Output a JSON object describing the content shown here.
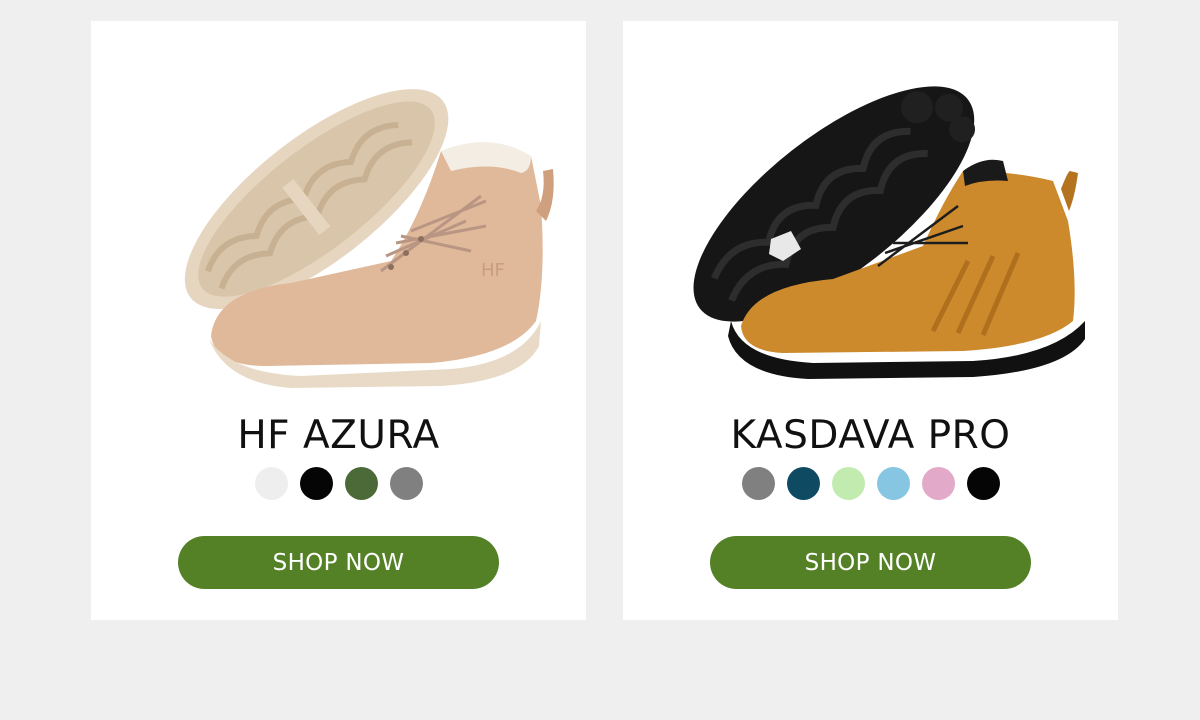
{
  "products": [
    {
      "name": "HF AZURA",
      "image_icon": "tan-winter-boot-pair",
      "swatches": [
        "#eeeeee",
        "#050505",
        "#4b6a38",
        "#808080"
      ],
      "button_label": "SHOP NOW"
    },
    {
      "name": "KASDAVA PRO",
      "image_icon": "brown-black-barefoot-boot-pair",
      "swatches": [
        "#808080",
        "#0f4a63",
        "#c2ebb0",
        "#86c6e3",
        "#e2a9c9",
        "#050505"
      ],
      "button_label": "SHOP NOW"
    }
  ],
  "colors": {
    "page_background": "#efefef",
    "card_background": "#ffffff",
    "button_green": "#548126"
  }
}
